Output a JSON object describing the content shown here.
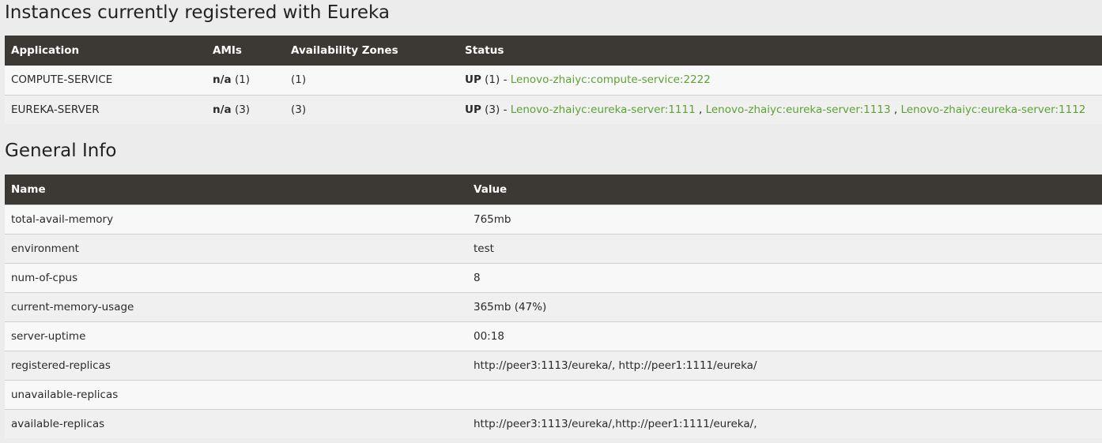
{
  "instances": {
    "title": "Instances currently registered with Eureka",
    "headers": [
      "Application",
      "AMIs",
      "Availability Zones",
      "Status"
    ],
    "rows": [
      {
        "application": "COMPUTE-SERVICE",
        "amis_label": "n/a",
        "amis_count": "(1)",
        "zones": "(1)",
        "status_label": "UP",
        "status_count": "(1) -",
        "links": [
          "Lenovo-zhaiyc:compute-service:2222"
        ]
      },
      {
        "application": "EUREKA-SERVER",
        "amis_label": "n/a",
        "amis_count": "(3)",
        "zones": "(3)",
        "status_label": "UP",
        "status_count": "(3) -",
        "links": [
          "Lenovo-zhaiyc:eureka-server:1111",
          "Lenovo-zhaiyc:eureka-server:1113",
          "Lenovo-zhaiyc:eureka-server:1112"
        ]
      }
    ]
  },
  "general_info": {
    "title": "General Info",
    "headers": [
      "Name",
      "Value"
    ],
    "rows": [
      {
        "name": "total-avail-memory",
        "value": "765mb"
      },
      {
        "name": "environment",
        "value": "test"
      },
      {
        "name": "num-of-cpus",
        "value": "8"
      },
      {
        "name": "current-memory-usage",
        "value": "365mb (47%)"
      },
      {
        "name": "server-uptime",
        "value": "00:18"
      },
      {
        "name": "registered-replicas",
        "value": "http://peer3:1113/eureka/, http://peer1:1111/eureka/"
      },
      {
        "name": "unavailable-replicas",
        "value": ""
      },
      {
        "name": "available-replicas",
        "value": "http://peer3:1113/eureka/,http://peer1:1111/eureka/,"
      }
    ]
  },
  "colors": {
    "header_bg": "#3c3833",
    "link": "#5fa134",
    "page_bg": "#ececec"
  }
}
